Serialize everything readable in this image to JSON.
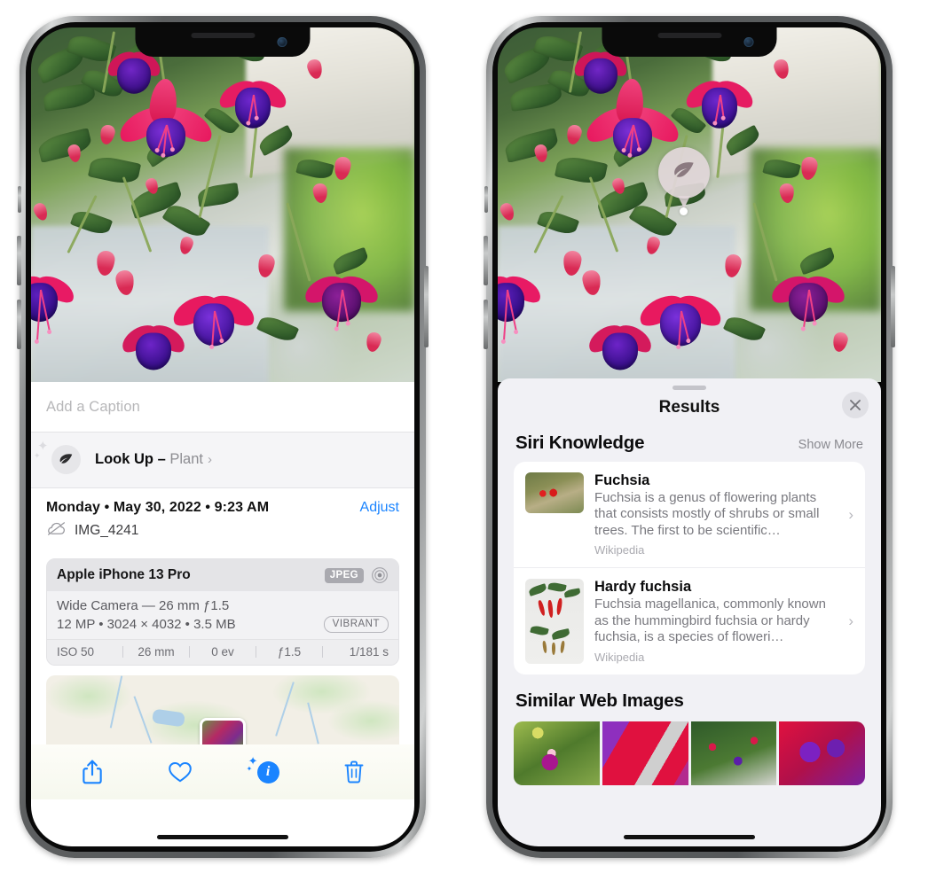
{
  "left_phone": {
    "caption_placeholder": "Add a Caption",
    "lookup": {
      "icon": "leaf-icon",
      "label": "Look Up",
      "dash": " – ",
      "subject": "Plant",
      "chevron": "›"
    },
    "metadata": {
      "date_line": "Monday • May 30, 2022 • 9:23 AM",
      "adjust_label": "Adjust",
      "cloud_icon": "cloud-slash-icon",
      "filename": "IMG_4241"
    },
    "camera_card": {
      "device": "Apple iPhone 13 Pro",
      "format_tag": "JPEG",
      "aperture_icon": "raw-circle-icon",
      "lens_line": "Wide Camera — 26 mm ƒ1.5",
      "specs_line": "12 MP • 3024 × 4032 • 3.5 MB",
      "style_tag": "VIBRANT",
      "exif": [
        "ISO 50",
        "26 mm",
        "0 ev",
        "ƒ1.5",
        "1/181 s"
      ]
    },
    "toolbar": [
      {
        "name": "share-icon",
        "label": "Share"
      },
      {
        "name": "heart-icon",
        "label": "Favorite"
      },
      {
        "name": "info-sparkle-icon",
        "label": "Info"
      },
      {
        "name": "trash-icon",
        "label": "Delete"
      }
    ]
  },
  "right_phone": {
    "visual_lookup_badge": {
      "icon": "leaf-icon"
    },
    "sheet": {
      "title": "Results",
      "close_icon": "close-icon",
      "sections": [
        {
          "title": "Siri Knowledge",
          "action_label": "Show More",
          "items": [
            {
              "title": "Fuchsia",
              "description": "Fuchsia is a genus of flowering plants that consists mostly of shrubs or small trees. The first to be scientific…",
              "source": "Wikipedia",
              "chevron": "›"
            },
            {
              "title": "Hardy fuchsia",
              "description": "Fuchsia magellanica, commonly known as the hummingbird fuchsia or hardy fuchsia, is a species of floweri…",
              "source": "Wikipedia",
              "chevron": "›"
            }
          ]
        },
        {
          "title": "Similar Web Images",
          "thumbnails": [
            "web-image-1",
            "web-image-2",
            "web-image-3",
            "web-image-4"
          ]
        }
      ]
    }
  },
  "colors": {
    "accent_blue": "#1a84ff",
    "sheet_bg": "#f1f1f5",
    "card_bg": "#ffffff",
    "secondary_text": "#8a8a90"
  }
}
